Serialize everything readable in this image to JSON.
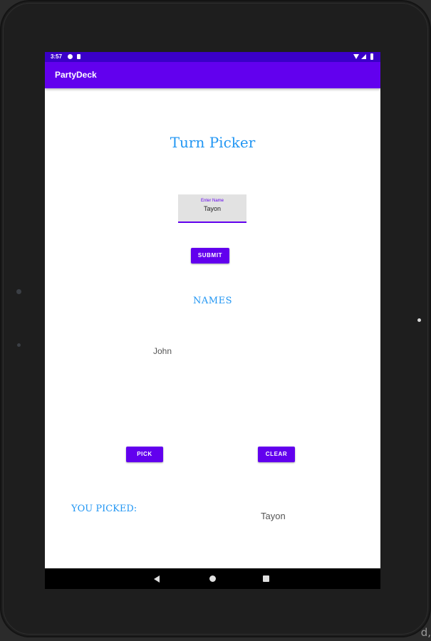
{
  "status_bar": {
    "time": "3:57",
    "icons": [
      "settings-icon",
      "sd-card-icon",
      "wifi-icon",
      "signal-icon",
      "battery-icon"
    ]
  },
  "app_bar": {
    "title": "PartyDeck"
  },
  "main": {
    "title": "Turn Picker",
    "name_input": {
      "label": "Enter Name",
      "value": "Tayon"
    },
    "submit_label": "SUBMIT",
    "names_heading": "NAMES",
    "names": [
      "John"
    ],
    "pick_label": "PICK",
    "clear_label": "CLEAR",
    "picked_label": "YOU PICKED:",
    "picked_value": "Tayon"
  },
  "nav_bar": {
    "icons": [
      "back-icon",
      "home-icon",
      "recents-icon"
    ]
  },
  "host": {
    "corner_text": "d,"
  },
  "colors": {
    "primary": "#6200ee",
    "primary_dark": "#3a00c8",
    "accent_text": "#2196f3"
  }
}
